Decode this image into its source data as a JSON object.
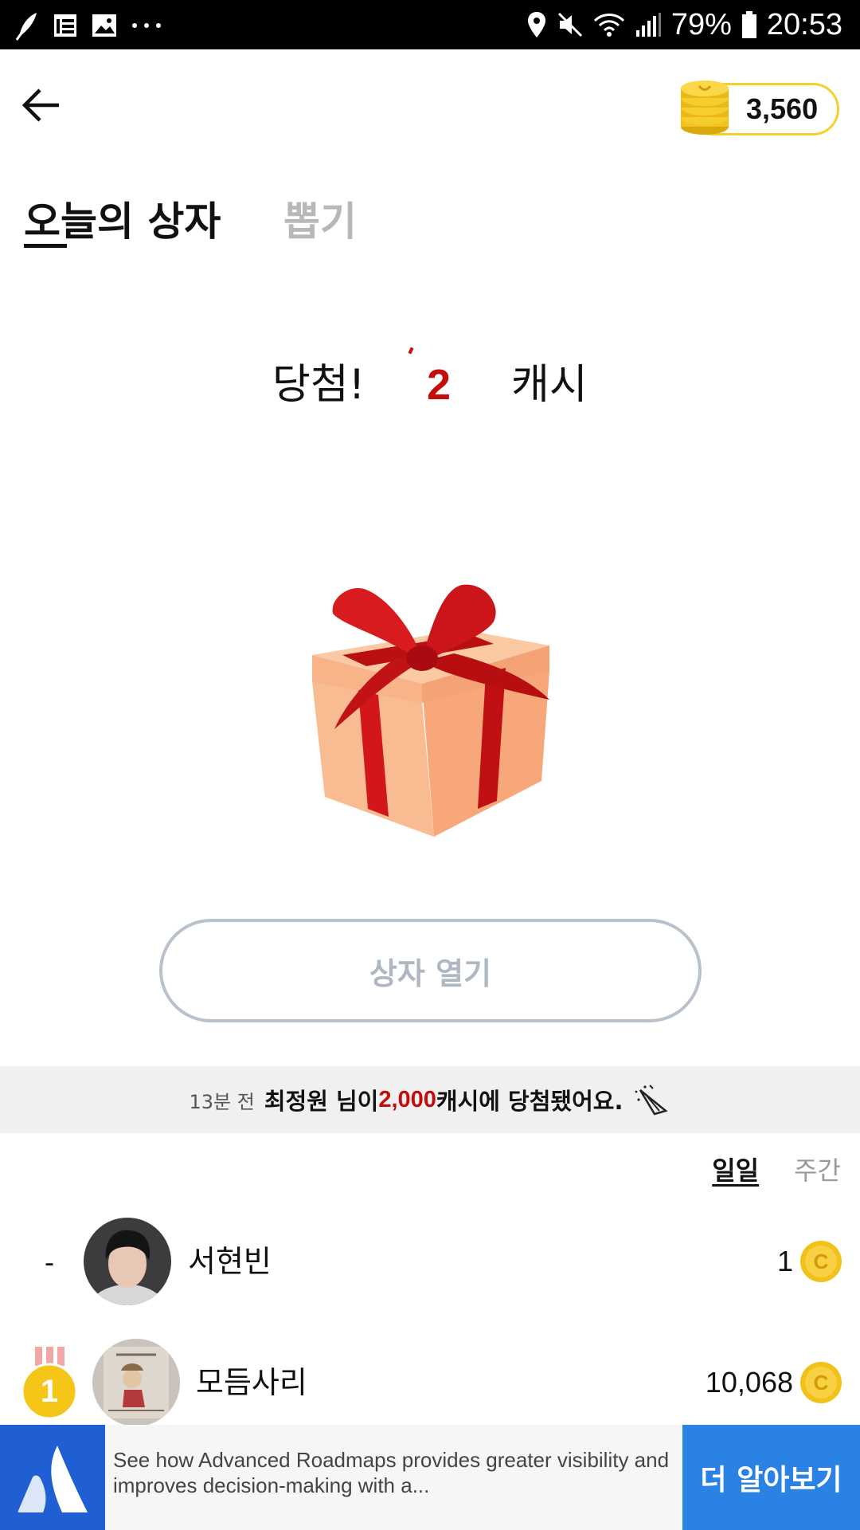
{
  "status_bar": {
    "battery": "79%",
    "time": "20:53",
    "left_icons": [
      "feather-icon",
      "grid-icon",
      "image-icon",
      "more-icon"
    ],
    "right_icons": [
      "location-icon",
      "mute-icon",
      "wifi-icon",
      "signal-icon",
      "battery-icon"
    ]
  },
  "header": {
    "coin_balance": "3,560"
  },
  "tabs": [
    {
      "label": "오늘의 상자",
      "active": true
    },
    {
      "label": "뽑기",
      "active": false
    }
  ],
  "result": {
    "prefix": "당첨!",
    "amount": "2",
    "suffix": "캐시"
  },
  "open_button": {
    "label": "상자 열기"
  },
  "notice": {
    "time": "13분 전",
    "name_text": "최정원 님이 ",
    "amount": "2,000",
    "tail": "캐시에 당첨됐어요."
  },
  "period_tabs": [
    {
      "label": "일일",
      "active": true
    },
    {
      "label": "주간",
      "active": false
    }
  ],
  "ranking": [
    {
      "rank": "-",
      "name": "서현빈",
      "score": "1"
    },
    {
      "rank": "1",
      "name": "모듬사리",
      "score": "10,068"
    }
  ],
  "ad": {
    "text": "See how Advanced Roadmaps provides greater visibility and improves decision-making with a...",
    "cta": "더 알아보기"
  },
  "colors": {
    "accent_red": "#c40d0d",
    "coin_gold": "#f5c518",
    "ad_blue": "#2a82e4",
    "gift_box": "#f9b389",
    "gift_ribbon": "#d2161a"
  }
}
